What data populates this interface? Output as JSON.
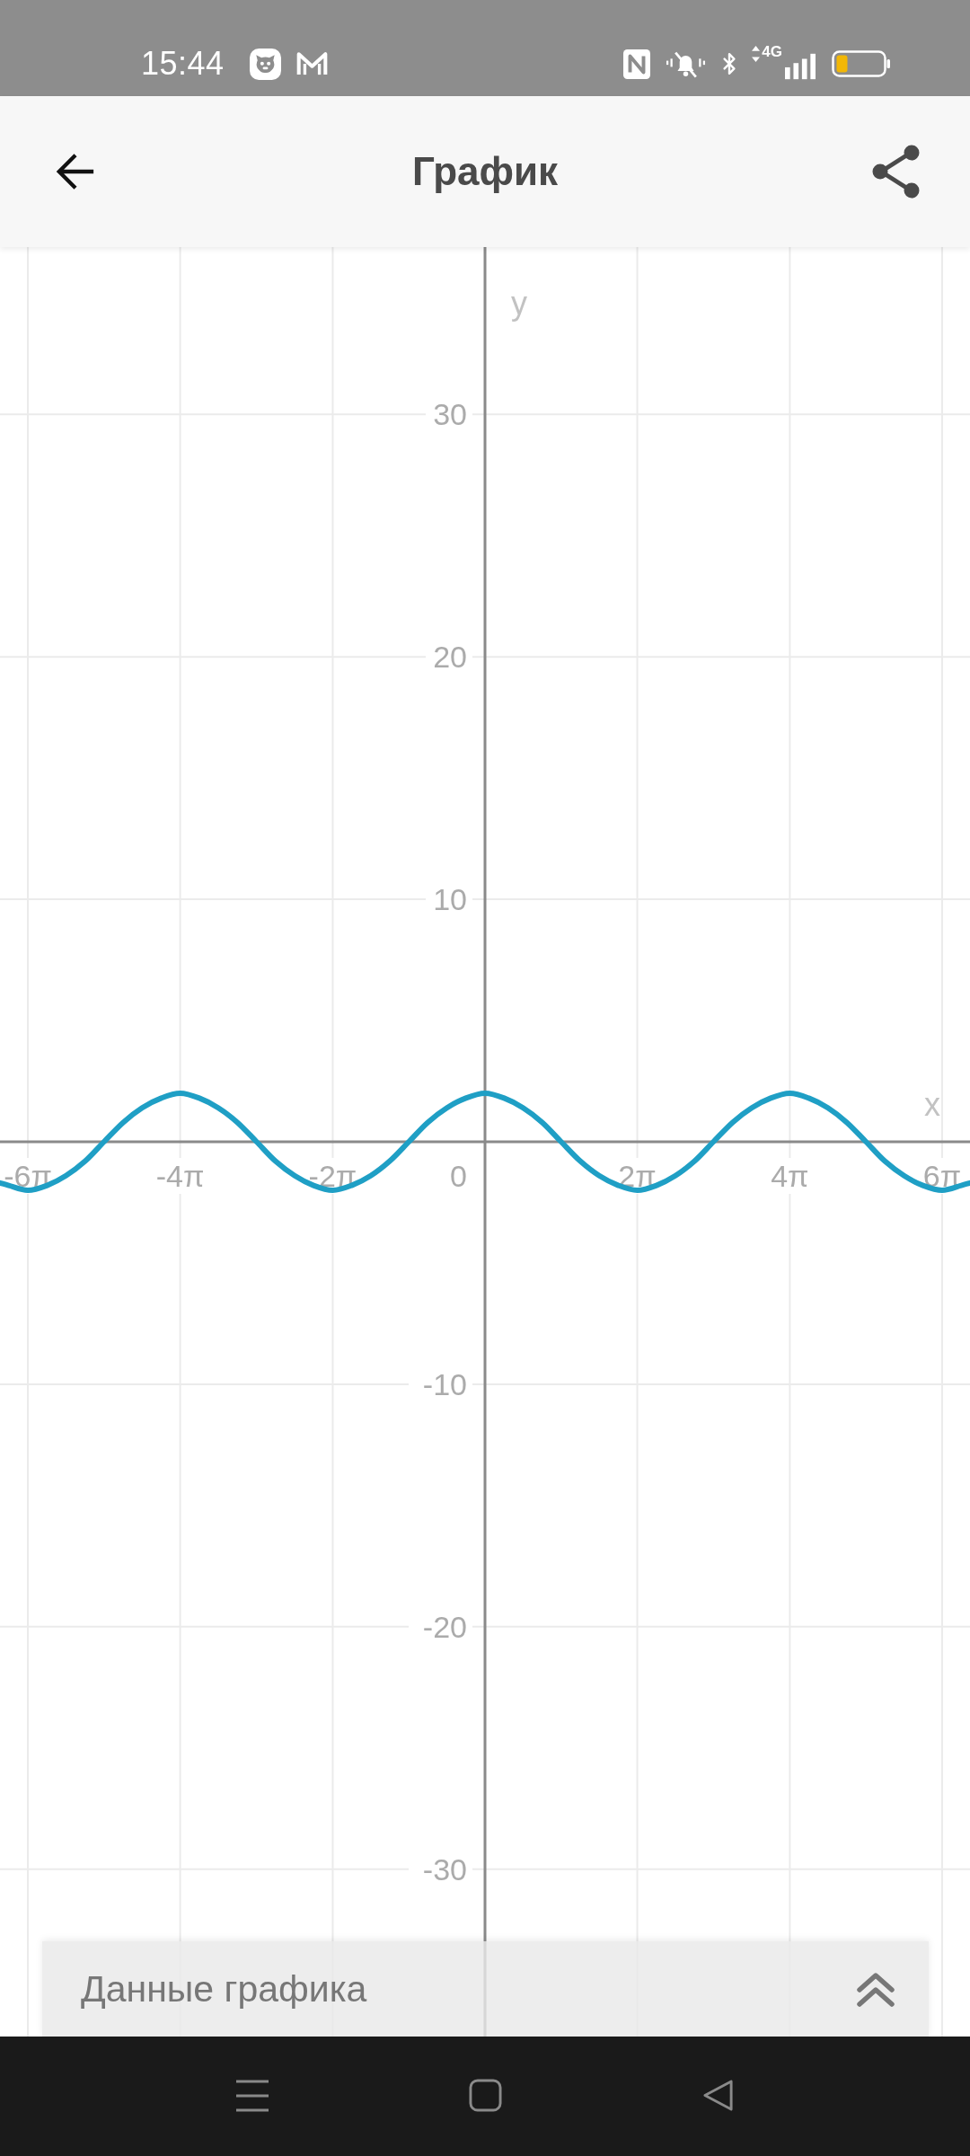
{
  "status_bar": {
    "time": "15:44",
    "network_type": "4G"
  },
  "app_bar": {
    "title": "График"
  },
  "graph": {
    "origin_label": "0",
    "chart_data": {
      "type": "line",
      "xlabel": "x",
      "ylabel": "y",
      "grid": true,
      "x": [
        -20,
        -19.64,
        -18.85,
        -18.06,
        -17.28,
        -16.49,
        -15.71,
        -14.92,
        -14.14,
        -13.35,
        -12.57,
        -11.78,
        -11,
        -10.21,
        -9.42,
        -8.64,
        -7.85,
        -7.07,
        -6.28,
        -5.5,
        -4.71,
        -3.93,
        -3.14,
        -2.36,
        -1.57,
        -0.79,
        0,
        0.79,
        1.57,
        2.36,
        3.14,
        3.93,
        4.71,
        5.5,
        6.28,
        7.07,
        7.85,
        8.64,
        9.42,
        10.21,
        11,
        11.78,
        12.57,
        13.35,
        14.14,
        14.92,
        15.71,
        16.49,
        17.28,
        18.06,
        18.85,
        19.64,
        20
      ],
      "series": [
        {
          "color": "#1f9fc5",
          "values": [
            -1.7,
            -1.8,
            -2,
            -1.8,
            -1.4,
            -0.8,
            0,
            0.8,
            1.4,
            1.8,
            2,
            1.8,
            1.4,
            0.8,
            0,
            -0.8,
            -1.4,
            -1.8,
            -2,
            -1.8,
            -1.4,
            -0.8,
            0,
            0.8,
            1.4,
            1.8,
            2,
            1.8,
            1.4,
            0.8,
            0,
            -0.8,
            -1.4,
            -1.8,
            -2,
            -1.8,
            -1.4,
            -0.8,
            0,
            0.8,
            1.4,
            1.8,
            2,
            1.8,
            1.4,
            0.8,
            0,
            -0.8,
            -1.4,
            -1.8,
            -2,
            -1.8,
            -1.7
          ]
        }
      ],
      "xlim": [
        -20,
        20
      ],
      "ylim": [
        -36.9,
        36.9
      ],
      "xticks": [
        {
          "value": -18.85,
          "label": "-6π"
        },
        {
          "value": -12.57,
          "label": "-4π"
        },
        {
          "value": -6.28,
          "label": "-2π"
        },
        {
          "value": 6.28,
          "label": "2π"
        },
        {
          "value": 12.57,
          "label": "4π"
        },
        {
          "value": 18.85,
          "label": "6π"
        }
      ],
      "yticks": [
        30,
        20,
        10,
        -10,
        -20,
        -30
      ]
    }
  },
  "data_panel": {
    "label": "Данные графика",
    "expanded": false
  }
}
